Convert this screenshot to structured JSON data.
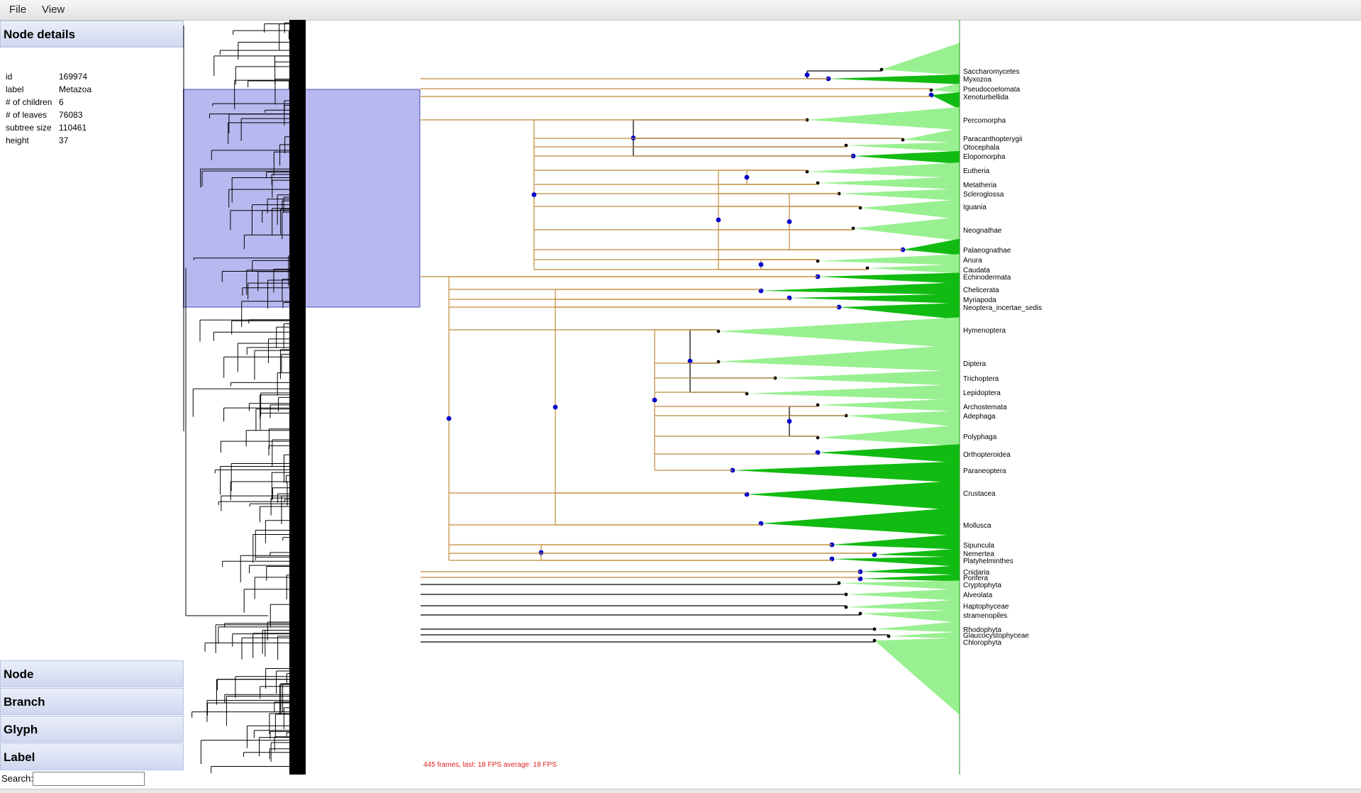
{
  "menu": {
    "file": "File",
    "view": "View"
  },
  "panel": {
    "header": "Node details",
    "rows": [
      {
        "key": "id",
        "value": "169974"
      },
      {
        "key": "label",
        "value": "Metazoa"
      },
      {
        "key": "# of children",
        "value": "6"
      },
      {
        "key": "# of leaves",
        "value": "76083"
      },
      {
        "key": "subtree size",
        "value": "110461"
      },
      {
        "key": "height",
        "value": "37"
      }
    ],
    "sections": [
      "Node",
      "Branch",
      "Glyph",
      "Label"
    ]
  },
  "search": {
    "label": "Search:",
    "value": ""
  },
  "fps": "445 frames, last: 18 FPS average: 18 FPS",
  "colors": {
    "branch_highlight": "#c08a3a",
    "node_dot": "#0000cc",
    "clade_light": "#99f090",
    "clade_dark": "#11bb11",
    "overview_select": "#b8b8f0"
  },
  "clades": [
    {
      "name": "Saccharomycetes",
      "dark": false
    },
    {
      "name": "Myxozoa",
      "dark": true
    },
    {
      "name": "Pseudocoelomata",
      "dark": false
    },
    {
      "name": "Xenoturbellida",
      "dark": true
    },
    {
      "name": "Percomorpha",
      "dark": false
    },
    {
      "name": "Paracanthopterygii",
      "dark": false
    },
    {
      "name": "Otocephala",
      "dark": false
    },
    {
      "name": "Elopomorpha",
      "dark": true
    },
    {
      "name": "Eutheria",
      "dark": false
    },
    {
      "name": "Metatheria",
      "dark": false
    },
    {
      "name": "Scleroglossa",
      "dark": false
    },
    {
      "name": "Iguania",
      "dark": false
    },
    {
      "name": "Neognathae",
      "dark": false
    },
    {
      "name": "Palaeognathae",
      "dark": true
    },
    {
      "name": "Anura",
      "dark": false
    },
    {
      "name": "Caudata",
      "dark": false
    },
    {
      "name": "Echinodermata",
      "dark": true
    },
    {
      "name": "Chelicerata",
      "dark": true
    },
    {
      "name": "Myriapoda",
      "dark": true
    },
    {
      "name": "Neoptera_incertae_sedis",
      "dark": true
    },
    {
      "name": "Hymenoptera",
      "dark": false
    },
    {
      "name": "Diptera",
      "dark": false
    },
    {
      "name": "Trichoptera",
      "dark": false
    },
    {
      "name": "Lepidoptera",
      "dark": false
    },
    {
      "name": "Archostemata",
      "dark": false
    },
    {
      "name": "Adephaga",
      "dark": false
    },
    {
      "name": "Polyphaga",
      "dark": false
    },
    {
      "name": "Orthopteroidea",
      "dark": true
    },
    {
      "name": "Paraneoptera",
      "dark": true
    },
    {
      "name": "Crustacea",
      "dark": true
    },
    {
      "name": "Mollusca",
      "dark": true
    },
    {
      "name": "Sipuncula",
      "dark": true
    },
    {
      "name": "Nemertea",
      "dark": true
    },
    {
      "name": "Platyhelminthes",
      "dark": true
    },
    {
      "name": "Cnidaria",
      "dark": true
    },
    {
      "name": "Porifera",
      "dark": true
    },
    {
      "name": "Cryptophyta",
      "dark": false
    },
    {
      "name": "Alveolata",
      "dark": false
    },
    {
      "name": "Haptophyceae",
      "dark": false
    },
    {
      "name": "stramenopiles",
      "dark": false
    },
    {
      "name": "Rhodophyta",
      "dark": false
    },
    {
      "name": "Glaucocystophyceae",
      "dark": false
    },
    {
      "name": "Chlorophyta",
      "dark": false
    }
  ]
}
